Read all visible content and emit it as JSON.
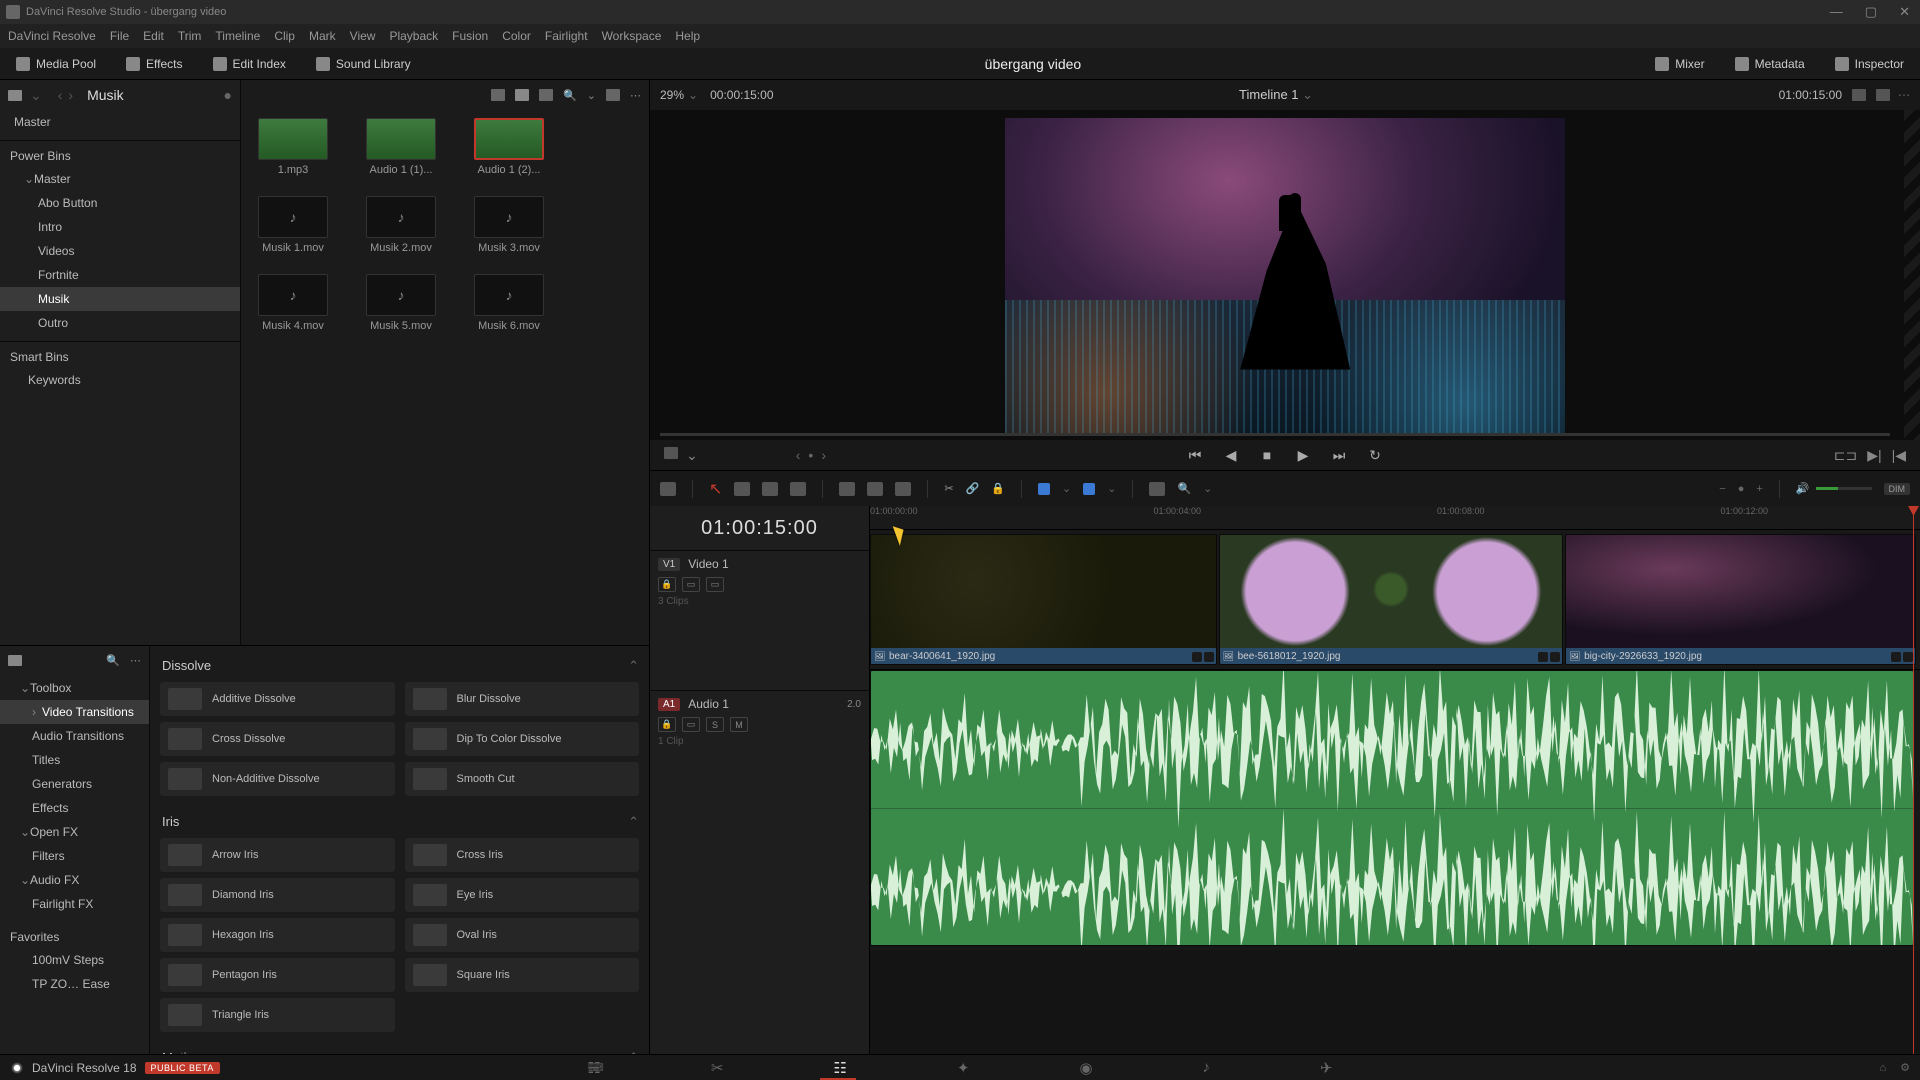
{
  "window_title": "DaVinci Resolve Studio - übergang video",
  "menubar": [
    "DaVinci Resolve",
    "File",
    "Edit",
    "Trim",
    "Timeline",
    "Clip",
    "Mark",
    "View",
    "Playback",
    "Fusion",
    "Color",
    "Fairlight",
    "Workspace",
    "Help"
  ],
  "topstrip": {
    "media_pool": "Media Pool",
    "effects": "Effects",
    "edit_index": "Edit Index",
    "sound_library": "Sound Library",
    "project": "übergang video",
    "mixer": "Mixer",
    "metadata": "Metadata",
    "inspector": "Inspector"
  },
  "bins": {
    "current": "Musik",
    "master": "Master",
    "power_bins_label": "Power Bins",
    "power_master": "Master",
    "power_items": [
      "Abo Button",
      "Intro",
      "Videos",
      "Fortnite",
      "Musik",
      "Outro"
    ],
    "power_selected": "Musik",
    "smart_bins_label": "Smart Bins",
    "smart_items": [
      "Keywords"
    ]
  },
  "media_clips": [
    {
      "label": "1.mp3",
      "wave": true,
      "sel": false
    },
    {
      "label": "Audio 1 (1)...",
      "wave": true,
      "sel": false
    },
    {
      "label": "Audio 1 (2)...",
      "wave": true,
      "sel": true
    },
    {
      "label": "Musik 1.mov",
      "wave": false,
      "sel": false
    },
    {
      "label": "Musik 2.mov",
      "wave": false,
      "sel": false
    },
    {
      "label": "Musik 3.mov",
      "wave": false,
      "sel": false
    },
    {
      "label": "Musik 4.mov",
      "wave": false,
      "sel": false
    },
    {
      "label": "Musik 5.mov",
      "wave": false,
      "sel": false
    },
    {
      "label": "Musik 6.mov",
      "wave": false,
      "sel": false
    }
  ],
  "fx_tree": {
    "toolbox": "Toolbox",
    "items": [
      "Video Transitions",
      "Audio Transitions",
      "Titles",
      "Generators",
      "Effects"
    ],
    "selected": "Video Transitions",
    "openfx": "Open FX",
    "openfx_items": [
      "Filters"
    ],
    "audiofx": "Audio FX",
    "audiofx_items": [
      "Fairlight FX"
    ],
    "favorites": "Favorites",
    "favorites_items": [
      "100mV Steps",
      "TP ZO… Ease"
    ]
  },
  "fx_panels": [
    {
      "title": "Dissolve",
      "items": [
        "Additive Dissolve",
        "Blur Dissolve",
        "Cross Dissolve",
        "Dip To Color Dissolve",
        "Non-Additive Dissolve",
        "Smooth Cut"
      ]
    },
    {
      "title": "Iris",
      "items": [
        "Arrow Iris",
        "Cross Iris",
        "Diamond Iris",
        "Eye Iris",
        "Hexagon Iris",
        "Oval Iris",
        "Pentagon Iris",
        "Square Iris",
        "Triangle Iris"
      ]
    },
    {
      "title": "Motion",
      "items": []
    }
  ],
  "viewer": {
    "zoom": "29%",
    "tc_left": "00:00:15:00",
    "timeline_name": "Timeline 1",
    "tc_right": "01:00:15:00"
  },
  "timeline": {
    "tc": "01:00:15:00",
    "ruler": [
      "01:00:00:00",
      "01:00:04:00",
      "01:00:08:00",
      "01:00:12:00"
    ],
    "video_track": {
      "badge": "V1",
      "name": "Video 1",
      "clips_meta": "3 Clips"
    },
    "audio_track": {
      "badge": "A1",
      "name": "Audio 1",
      "db": "2.0",
      "clips_meta": "1 Clip"
    },
    "vclips": [
      {
        "name": "bear-3400641_1920.jpg"
      },
      {
        "name": "bee-5618012_1920.jpg"
      },
      {
        "name": "big-city-2926633_1920.jpg"
      }
    ]
  },
  "footer": {
    "version": "DaVinci Resolve 18",
    "beta": "PUBLIC BETA"
  }
}
